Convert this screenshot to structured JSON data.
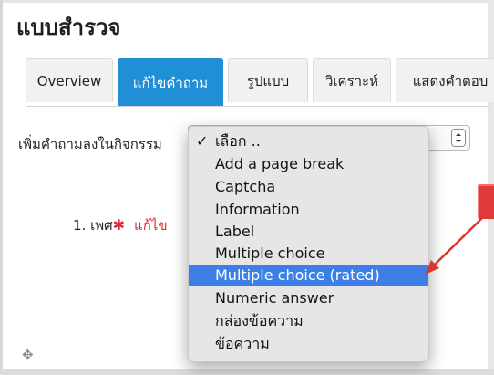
{
  "page": {
    "title": "แบบสำรวจ"
  },
  "tabs": [
    {
      "label": "Overview",
      "active": false
    },
    {
      "label": "แก้ไขคำถาม",
      "active": true
    },
    {
      "label": "รูปแบบ",
      "active": false
    },
    {
      "label": "วิเคราะห์",
      "active": false
    },
    {
      "label": "แสดงคำตอบ",
      "active": false
    }
  ],
  "add_question": {
    "label": "เพิ่มคำถามลงในกิจกรรม",
    "selected": "เลือก ..",
    "options": [
      "เลือก ..",
      "Add a page break",
      "Captcha",
      "Information",
      "Label",
      "Multiple choice",
      "Multiple choice (rated)",
      "Numeric answer",
      "กล่องข้อความ",
      "ข้อความ"
    ],
    "highlighted_option": "Multiple choice (rated)"
  },
  "question": {
    "number_label": "1. เพศ",
    "required_mark": "✱",
    "edit_label": "แก้ไข"
  },
  "icons": {
    "move": "move-icon",
    "check": "checkmark-icon",
    "select_arrows": "select-arrows-icon"
  },
  "colors": {
    "accent": "#1f8fd6",
    "highlight": "#3d7fe6",
    "required": "#e0293d",
    "annotation": "#e03a38"
  }
}
